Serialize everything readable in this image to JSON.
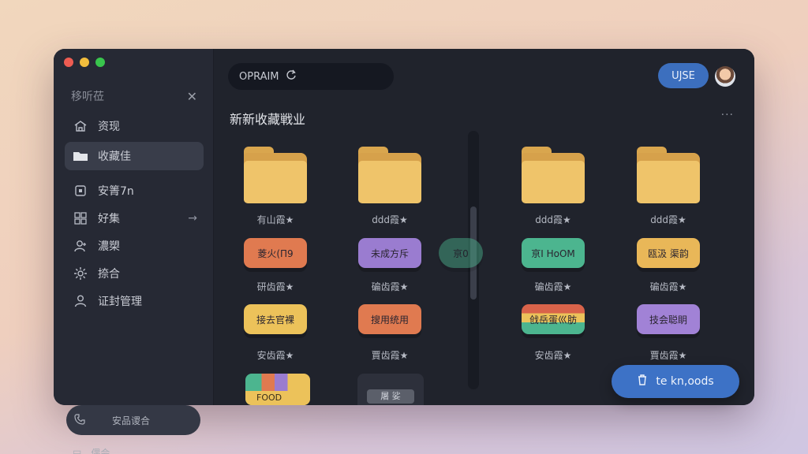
{
  "sidebar": {
    "header": "移听莅",
    "items": [
      {
        "label": "资现",
        "icon": "home-icon",
        "active": false
      },
      {
        "label": "收藏佳",
        "icon": "folder-icon",
        "active": true
      },
      {
        "label": "安箐7n",
        "icon": "square-icon",
        "active": false
      },
      {
        "label": "好集",
        "icon": "grid-icon",
        "active": false
      },
      {
        "label": "濃槊",
        "icon": "user-icon",
        "active": false
      },
      {
        "label": "捺合",
        "icon": "gear-icon",
        "active": false
      },
      {
        "label": "证封管理",
        "icon": "person-icon",
        "active": false
      }
    ],
    "bottom_button": "安品谡合",
    "bottom_item": "偶会"
  },
  "toolbar": {
    "search_text": "OPRAIM",
    "use_button": "UJSE"
  },
  "section": {
    "title": "新新收藏戦业",
    "more": "···"
  },
  "folders": [
    {
      "caption": "有山霞★"
    },
    {
      "caption": "ddd霞★"
    },
    {
      "caption": "ddd霞★"
    },
    {
      "caption": "ddd霞★"
    }
  ],
  "row2": [
    {
      "label": "菱火(П9",
      "color": "#e07a50",
      "caption": "研齿霞★"
    },
    {
      "label": "未成方斥",
      "color": "#9a7cd0",
      "caption": "碥齿霞★"
    },
    {
      "label": "亰I HoOM",
      "color": "#4cb58f",
      "caption": "碥齿霞★"
    },
    {
      "label": "瓯汲 渠韵",
      "color": "#e9b758",
      "caption": "碥齿霞★"
    }
  ],
  "ghost_pill": "亰0",
  "row3": [
    {
      "label": "接去官裸",
      "color": "#ecc25a",
      "caption": "安齿霞★"
    },
    {
      "label": "搜用统用",
      "color": "#e07a50",
      "caption": "賈齿霞★"
    },
    {
      "label": "戗岳蛋巛肪",
      "color": "#d97a55",
      "caption": "安齿霞★"
    },
    {
      "label": "技会聪眀",
      "color": "#a182d6",
      "caption": "賈齿霞★"
    }
  ],
  "row4": {
    "food_label": "FOOD",
    "dark_label": "屠 娑"
  },
  "fab": {
    "label": "te kn,oods"
  },
  "below": {
    "dots1": "···",
    "dots2": "···"
  },
  "colors": {
    "accent": "#3d72c6",
    "folder": "#efc46a"
  }
}
